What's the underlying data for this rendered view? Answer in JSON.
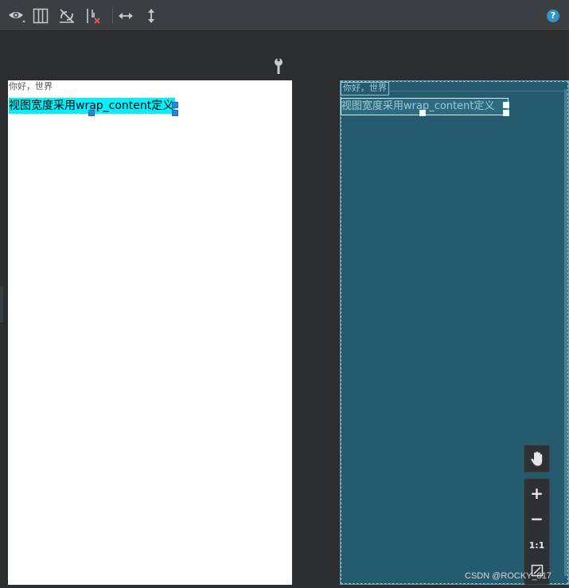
{
  "toolbar": {
    "icons": [
      "eye-icon",
      "blueprint-columns-icon",
      "hide-constraints-icon",
      "clear-constraints-icon",
      "expand-horizontal-icon",
      "expand-vertical-icon",
      "help-icon"
    ],
    "help_label": "?"
  },
  "design": {
    "hello_text": "你好，世界",
    "selected_text": "视图宽度采用wrap_content定义"
  },
  "blueprint": {
    "hello_text": "你好，世界",
    "selected_text": "视图宽度采用wrap_content定义"
  },
  "zoom": {
    "zoom_in_label": "+",
    "zoom_out_label": "−",
    "actual_size_label": "1:1"
  },
  "watermark": "CSDN @ROCKY_817",
  "colors": {
    "toolbar_bg": "#3c3f41",
    "canvas_bg": "#2b2d2f",
    "selection_fill": "#00f1fb",
    "handle_blue": "#2a84d7",
    "blueprint_bg": "#245b6e"
  }
}
